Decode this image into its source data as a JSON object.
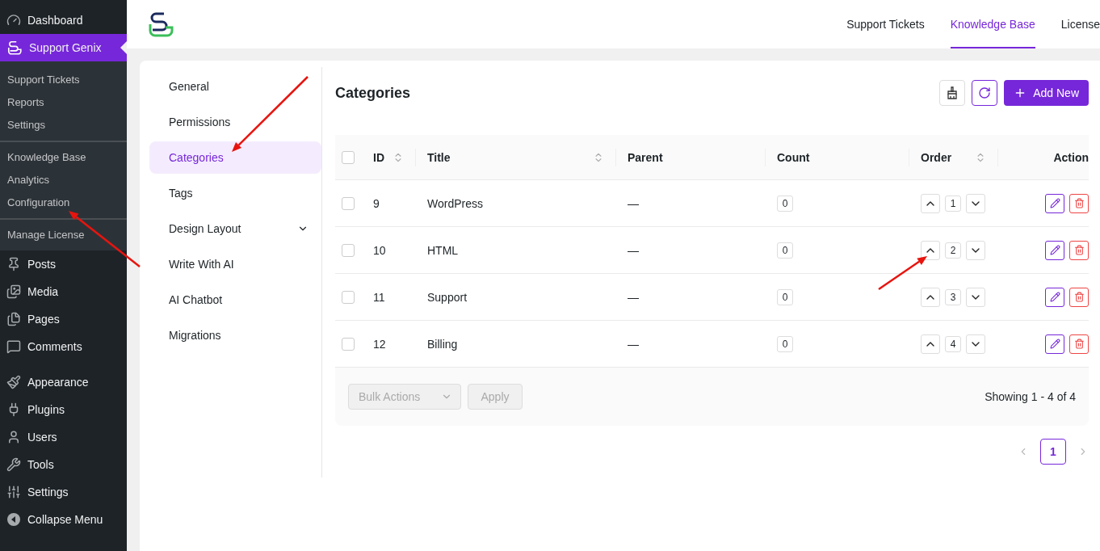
{
  "sidebar": {
    "items": [
      {
        "label": "Dashboard",
        "selected": false
      },
      {
        "label": "Support Genix",
        "selected": true,
        "submenu": [
          [
            {
              "label": "Support Tickets",
              "selected": false
            },
            {
              "label": "Reports",
              "selected": false
            },
            {
              "label": "Settings",
              "selected": false
            }
          ],
          [
            {
              "label": "Knowledge Base",
              "selected": false
            },
            {
              "label": "Analytics",
              "selected": false
            },
            {
              "label": "Configuration",
              "selected": false
            }
          ],
          [
            {
              "label": "Manage License",
              "selected": false
            }
          ]
        ]
      },
      {
        "label": "Posts",
        "selected": false
      },
      {
        "label": "Media",
        "selected": false
      },
      {
        "label": "Pages",
        "selected": false
      },
      {
        "label": "Comments",
        "selected": false
      },
      {
        "label": "Appearance",
        "selected": false
      },
      {
        "label": "Plugins",
        "selected": false
      },
      {
        "label": "Users",
        "selected": false
      },
      {
        "label": "Tools",
        "selected": false
      },
      {
        "label": "Settings",
        "selected": false
      },
      {
        "label": "Collapse Menu",
        "selected": false
      }
    ]
  },
  "top_nav": [
    {
      "label": "Support Tickets",
      "selected": false
    },
    {
      "label": "Knowledge Base",
      "selected": true
    },
    {
      "label": "License",
      "selected": false
    }
  ],
  "settings_menu": [
    {
      "label": "General",
      "selected": false,
      "expandable": false
    },
    {
      "label": "Permissions",
      "selected": false,
      "expandable": false
    },
    {
      "label": "Categories",
      "selected": true,
      "expandable": false
    },
    {
      "label": "Tags",
      "selected": false,
      "expandable": false
    },
    {
      "label": "Design Layout",
      "selected": false,
      "expandable": true
    },
    {
      "label": "Write With AI",
      "selected": false,
      "expandable": false
    },
    {
      "label": "AI Chatbot",
      "selected": false,
      "expandable": false
    },
    {
      "label": "Migrations",
      "selected": false,
      "expandable": false
    }
  ],
  "page_title": "Categories",
  "add_button": "Add New",
  "table": {
    "header_checked": false,
    "columns": [
      {
        "label": "ID",
        "sortable": true
      },
      {
        "label": "Title",
        "sortable": true
      },
      {
        "label": "Parent",
        "sortable": false
      },
      {
        "label": "Count",
        "sortable": false
      },
      {
        "label": "Order",
        "sortable": true
      },
      {
        "label": "Action",
        "sortable": false
      }
    ],
    "rows": [
      {
        "checked": false,
        "id": "9",
        "title": "WordPress",
        "parent": "—",
        "count": "0",
        "order": "1"
      },
      {
        "checked": false,
        "id": "10",
        "title": "HTML",
        "parent": "—",
        "count": "0",
        "order": "2"
      },
      {
        "checked": false,
        "id": "11",
        "title": "Support",
        "parent": "—",
        "count": "0",
        "order": "3"
      },
      {
        "checked": false,
        "id": "12",
        "title": "Billing",
        "parent": "—",
        "count": "0",
        "order": "4"
      }
    ]
  },
  "bulk_actions": {
    "placeholder": "Bulk Actions",
    "disabled": true
  },
  "apply_button": {
    "label": "Apply",
    "disabled": true
  },
  "showing": "Showing 1 - 4 of 4",
  "pagination": [
    {
      "label": "1",
      "selected": true
    }
  ]
}
